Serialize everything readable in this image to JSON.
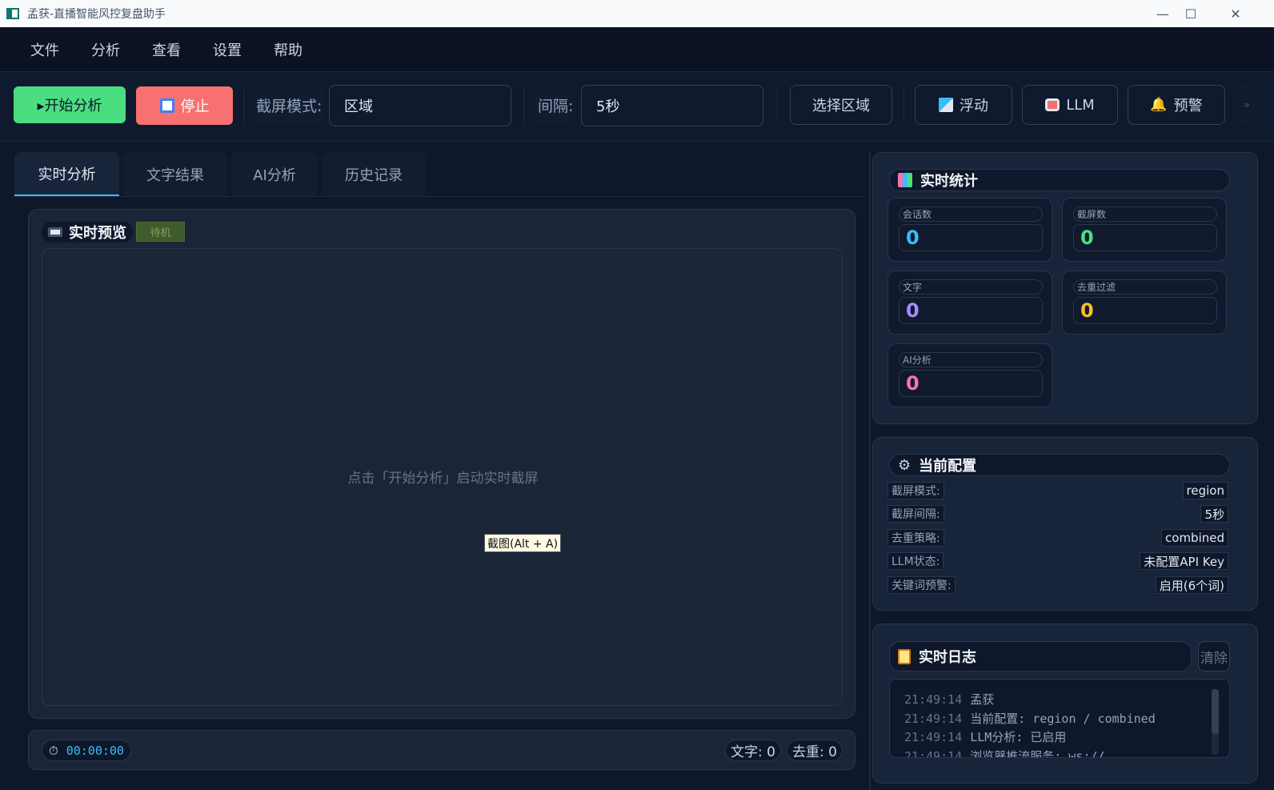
{
  "window": {
    "title": "孟获-直播智能风控复盘助手",
    "min": "—",
    "max": "☐",
    "close": "✕"
  },
  "menu": [
    "文件",
    "分析",
    "查看",
    "设置",
    "帮助"
  ],
  "toolbar": {
    "start": "▸开始分析",
    "stop": "停止",
    "capture_mode_label": "截屏模式:",
    "capture_mode_value": "区域",
    "interval_label": "间隔:",
    "interval_value": "5秒",
    "select_region": "选择区域",
    "float": "浮动",
    "llm": "LLM",
    "alert": "预警",
    "more": "»"
  },
  "tabs": [
    "实时分析",
    "文字结果",
    "AI分析",
    "历史记录"
  ],
  "preview": {
    "title": "实时预览",
    "status": "待机",
    "hint": "点击「开始分析」启动实时截屏",
    "tooltip": "截图(Alt + A)"
  },
  "bottom": {
    "timer": "00:00:00",
    "text_count": "文字: 0",
    "dedup_count": "去重: 0"
  },
  "stats": {
    "title": "实时统计",
    "items": [
      {
        "label": "会话数",
        "value": "0",
        "color": "#38bdf8"
      },
      {
        "label": "截屏数",
        "value": "0",
        "color": "#4ade80"
      },
      {
        "label": "文字",
        "value": "0",
        "color": "#a78bfa"
      },
      {
        "label": "去重过滤",
        "value": "0",
        "color": "#fbbf24"
      },
      {
        "label": "AI分析",
        "value": "0",
        "color": "#f472b6"
      }
    ]
  },
  "config": {
    "title": "当前配置",
    "rows": [
      {
        "k": "截屏模式:",
        "v": "region"
      },
      {
        "k": "截屏间隔:",
        "v": "5秒"
      },
      {
        "k": "去重策略:",
        "v": "combined"
      },
      {
        "k": "LLM状态:",
        "v": "未配置API Key"
      },
      {
        "k": "关键词预警:",
        "v": "启用(6个词)"
      }
    ]
  },
  "log": {
    "title": "实时日志",
    "clear": "清除",
    "lines": [
      {
        "t": "21:49:14",
        "m": "孟获"
      },
      {
        "t": "21:49:14",
        "m": "当前配置: region / combined"
      },
      {
        "t": "21:49:14",
        "m": "LLM分析: 已启用"
      },
      {
        "t": "21:49:14",
        "m": "浏览器推流服务: ws://"
      }
    ]
  }
}
